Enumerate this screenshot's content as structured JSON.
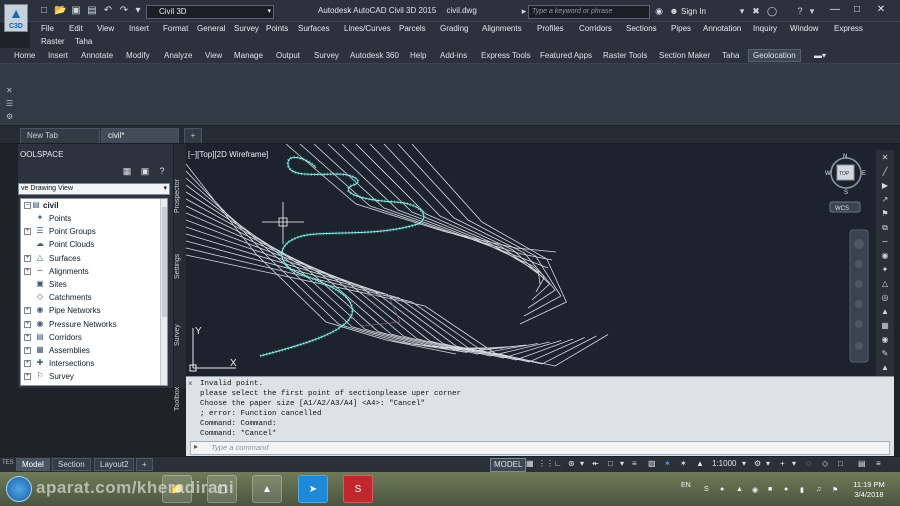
{
  "app": {
    "window_title": "Autodesk AutoCAD Civil 3D 2015",
    "file_name": "civil.dwg",
    "logo_text": "C3D",
    "workspace": "Civil 3D",
    "search_placeholder": "Type a keyword or phrase",
    "signin": "Sign In"
  },
  "menubar": {
    "row1": [
      "File",
      "Edit",
      "View",
      "Insert",
      "Format",
      "General",
      "Survey",
      "Points",
      "Surfaces",
      "Lines/Curves",
      "Parcels",
      "Grading",
      "Alignments",
      "Profiles",
      "Corridors",
      "Sections",
      "Pipes",
      "Annotation",
      "Inquiry",
      "Window",
      "Express"
    ],
    "row2": [
      "Raster",
      "Taha"
    ]
  },
  "ribbon_tabs": [
    "Home",
    "Insert",
    "Annotate",
    "Modify",
    "Analyze",
    "View",
    "Manage",
    "Output",
    "Survey",
    "Autodesk 360",
    "Help",
    "Add-ins",
    "Express Tools",
    "Featured Apps",
    "Raster Tools",
    "Section Maker",
    "Taha",
    "Geolocation"
  ],
  "ribbon_active": "Geolocation",
  "file_tabs": {
    "new_tab": "New Tab",
    "drawing": "civil*",
    "add": "+"
  },
  "toolspace": {
    "title": "OOLSPACE",
    "view_select": "ve Drawing View",
    "root": "civil",
    "items": [
      "Points",
      "Point Groups",
      "Point Clouds",
      "Surfaces",
      "Alignments",
      "Sites",
      "Catchments",
      "Pipe Networks",
      "Pressure Networks",
      "Corridors",
      "Assemblies",
      "Intersections",
      "Survey"
    ],
    "expandable": [
      false,
      true,
      false,
      true,
      true,
      false,
      false,
      true,
      true,
      true,
      true,
      true,
      true
    ],
    "side_tabs": [
      "Prospector",
      "Settings",
      "Survey",
      "Toolbox"
    ]
  },
  "viewport": {
    "label": "[−][Top][2D Wireframe]",
    "viewcube": {
      "n": "N",
      "s": "S",
      "e": "E",
      "w": "W",
      "top": "TOP",
      "wcs": "WCS"
    },
    "ucs": {
      "x": "X",
      "y": "Y"
    }
  },
  "command": {
    "history": [
      "Invalid point.",
      "please select the first point of sectionplease uper corner",
      "Choose the paper size [A1/A2/A3/A4] <A4>: \"Cancel\"",
      "; error: Function cancelled",
      "Command: Command:",
      "Command: *Cancel*"
    ],
    "placeholder": "Type a command",
    "close_glyph": "×"
  },
  "layout_tabs": [
    "Model",
    "Section",
    "Layout2"
  ],
  "layout_add": "+",
  "layout_side_label": "TES",
  "status": {
    "model": "MODEL",
    "scale": "1:1000"
  },
  "taskbar": {
    "watermark": "aparat.com/kheradirani",
    "lang": "EN",
    "time": "11:19 PM",
    "date": "3/4/2018"
  }
}
